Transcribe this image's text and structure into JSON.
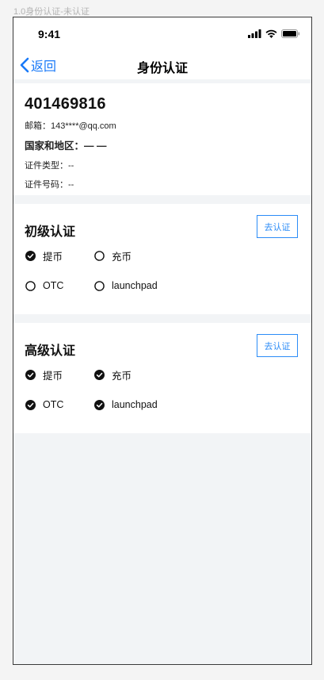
{
  "artboard_label": "1.0身份认证-未认证",
  "status_bar": {
    "time": "9:41"
  },
  "nav": {
    "back_label": "返回",
    "title": "身份认证"
  },
  "profile": {
    "user_id": "401469816",
    "email": "邮箱：143****@qq.com",
    "region": "国家和地区：— —",
    "id_type": "证件类型：--",
    "id_number": "证件号码：--"
  },
  "basic_cert": {
    "title": "初级认证",
    "button": "去认证",
    "permissions": [
      {
        "label": "提币",
        "checked": true
      },
      {
        "label": "充币",
        "checked": false
      },
      {
        "label": "OTC",
        "checked": false
      },
      {
        "label": "launchpad",
        "checked": false
      }
    ]
  },
  "advanced_cert": {
    "title": "高级认证",
    "button": "去认证",
    "permissions": [
      {
        "label": "提币",
        "checked": true
      },
      {
        "label": "充币",
        "checked": true
      },
      {
        "label": "OTC",
        "checked": true
      },
      {
        "label": "launchpad",
        "checked": true
      }
    ]
  },
  "colors": {
    "accent": "#1a7af8",
    "button_border": "#2c8cf7",
    "page_bg": "#f2f4f6"
  }
}
